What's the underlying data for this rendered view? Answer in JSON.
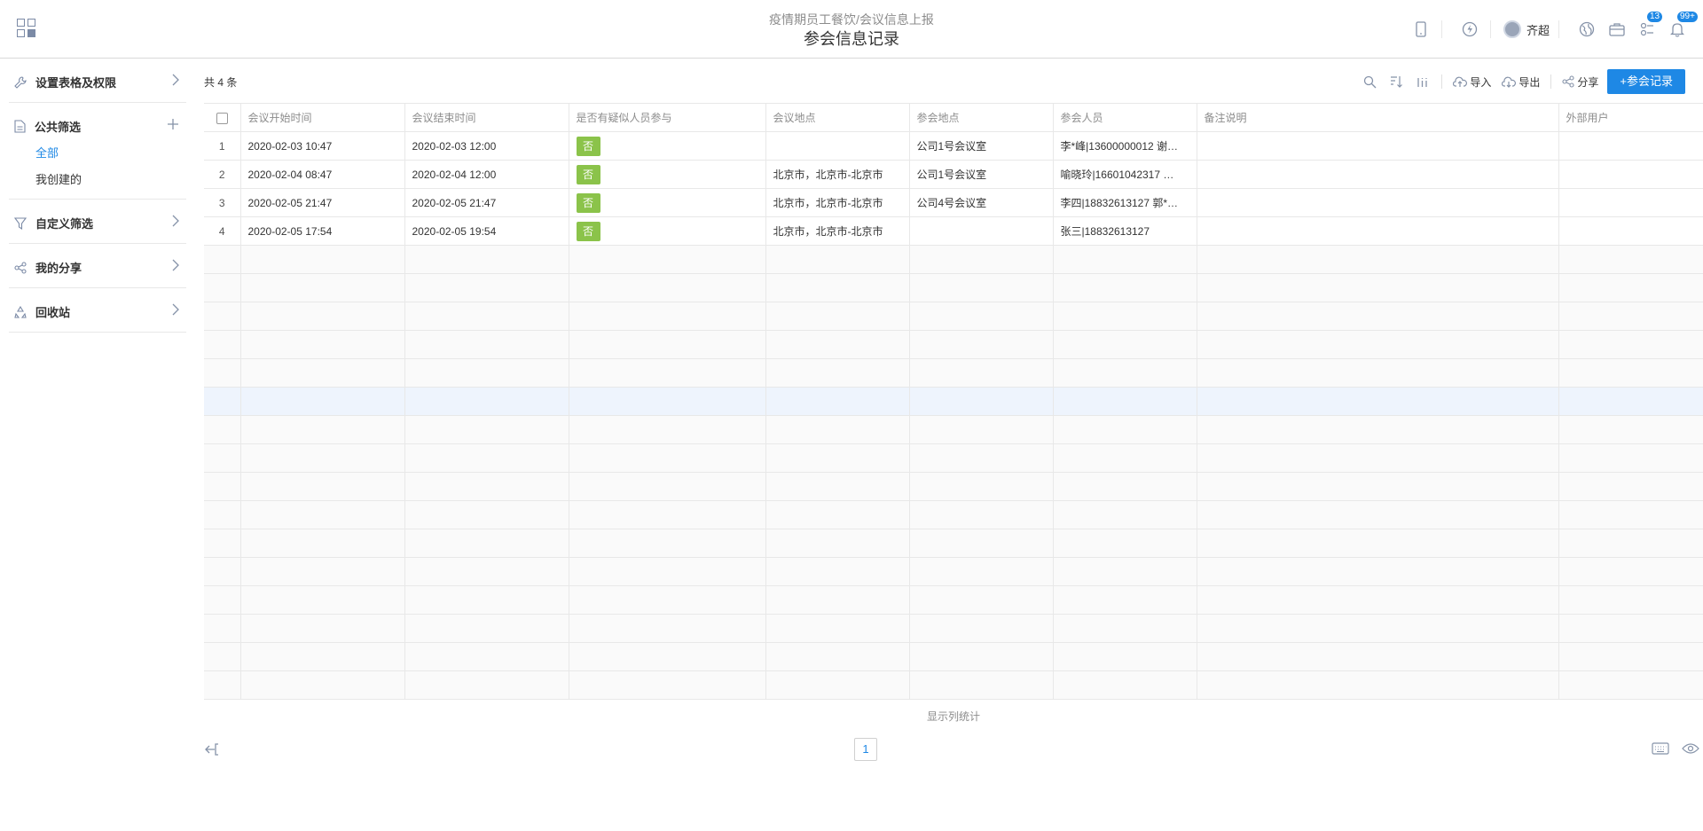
{
  "header": {
    "breadcrumb_app": "疫情期员工餐饮",
    "breadcrumb_sep": "/",
    "breadcrumb_sheet": "会议信息上报",
    "title": "参会信息记录",
    "user_name": "齐超",
    "badge_1": "13",
    "badge_2": "99+"
  },
  "sidebar": {
    "settings_label": "设置表格及权限",
    "public_filter_label": "公共筛选",
    "sub_all": "全部",
    "sub_mine": "我创建的",
    "custom_filter_label": "自定义筛选",
    "my_share_label": "我的分享",
    "recycle_label": "回收站"
  },
  "toolbar": {
    "count": "共 4 条",
    "import": "导入",
    "export": "导出",
    "share": "分享",
    "add": "+参会记录"
  },
  "table": {
    "headers": [
      "会议开始时间",
      "会议结束时间",
      "是否有疑似人员参与",
      "会议地点",
      "参会地点",
      "参会人员",
      "备注说明",
      "外部用户"
    ],
    "rows": [
      {
        "idx": "1",
        "start": "2020-02-03 10:47",
        "end": "2020-02-03 12:00",
        "suspect": "否",
        "meeting_place": "",
        "attend_place": "公司1号会议室",
        "people": "李*峰|13600000012 谢…",
        "note": "",
        "external": ""
      },
      {
        "idx": "2",
        "start": "2020-02-04 08:47",
        "end": "2020-02-04 12:00",
        "suspect": "否",
        "meeting_place": "北京市，北京市-北京市",
        "attend_place": "公司1号会议室",
        "people": "喻晓玲|16601042317 …",
        "note": "",
        "external": ""
      },
      {
        "idx": "3",
        "start": "2020-02-05 21:47",
        "end": "2020-02-05 21:47",
        "suspect": "否",
        "meeting_place": "北京市，北京市-北京市",
        "attend_place": "公司4号会议室",
        "people": "李四|18832613127 郭*…",
        "note": "",
        "external": ""
      },
      {
        "idx": "4",
        "start": "2020-02-05 17:54",
        "end": "2020-02-05 19:54",
        "suspect": "否",
        "meeting_place": "北京市，北京市-北京市",
        "attend_place": "",
        "people": "张三|18832613127",
        "note": "",
        "external": ""
      }
    ]
  },
  "footer": {
    "stat_label": "显示列统计",
    "page": "1"
  },
  "colors": {
    "accent": "#1e88e5",
    "tag_green": "#8bc34a"
  }
}
